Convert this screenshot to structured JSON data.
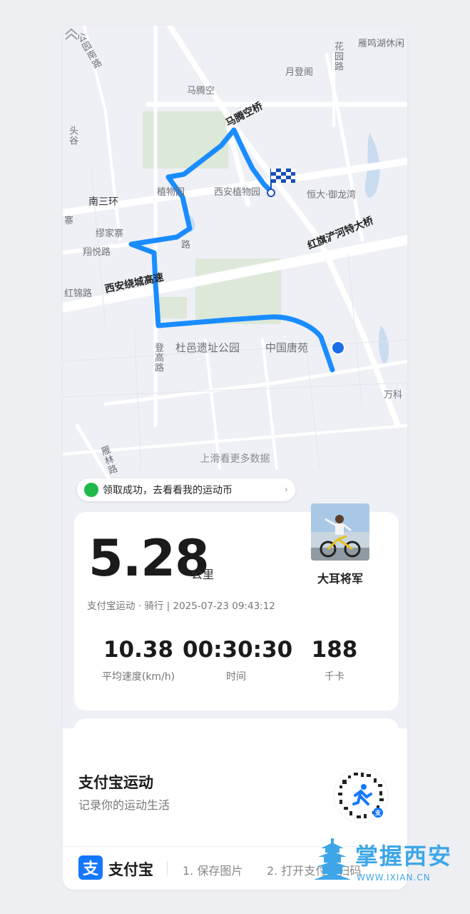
{
  "map": {
    "labels": {
      "gongyuan_road": "公园南路",
      "yanmingdu": "雁鸣湖休闲",
      "huayuan_road": "花园路",
      "yuedeng_road": "月登阁",
      "matengkong": "马腾空",
      "matengkong_bridge": "马腾空桥",
      "xian_botanical": "西安植物园",
      "hengda": "恒大·御龙湾",
      "nansanhuan": "南三环",
      "zhiwuyuan": "植物园",
      "hongqi_bridge": "红旗浐河特大桥",
      "miaojiazhai": "缪家寨",
      "xiangyue_road": "翔悦路",
      "huancheng_expressway": "西安绕城高速",
      "hongjin_road": "红锦路",
      "duyi_park": "杜邑遗址公园",
      "tangyuan": "中国唐苑",
      "denggao_road": "登高路",
      "wanke": "万科",
      "yanlin_road": "雁林路",
      "tou_gu": "头谷",
      "zhai": "寨",
      "lu": "路"
    },
    "swipe_hint": "上滑看更多数据"
  },
  "toast": {
    "text": "领取成功，去看看我的运动币"
  },
  "activity": {
    "distance": "5.28",
    "distance_unit": "公里",
    "meta": "支付宝运动 · 骑行 | 2025-07-23 09:43:12",
    "username": "大耳将军",
    "metrics": [
      {
        "value": "10.38",
        "label": "平均速度(km/h)"
      },
      {
        "value": "00:30:30",
        "label": "时间"
      },
      {
        "value": "188",
        "label": "千卡"
      }
    ]
  },
  "footer": {
    "title": "支付宝运动",
    "subtitle": "记录你的运动生活",
    "logo_char": "支",
    "logo_text": "支付宝",
    "step1": "1. 保存图片",
    "step2": "2. 打开支付宝扫码"
  },
  "watermark": {
    "title": "掌握西安",
    "url": "WWW.IXIAN.CN"
  },
  "colors": {
    "route": "#1a8cff",
    "accent": "#1677ff",
    "ok": "#1fb94b"
  }
}
